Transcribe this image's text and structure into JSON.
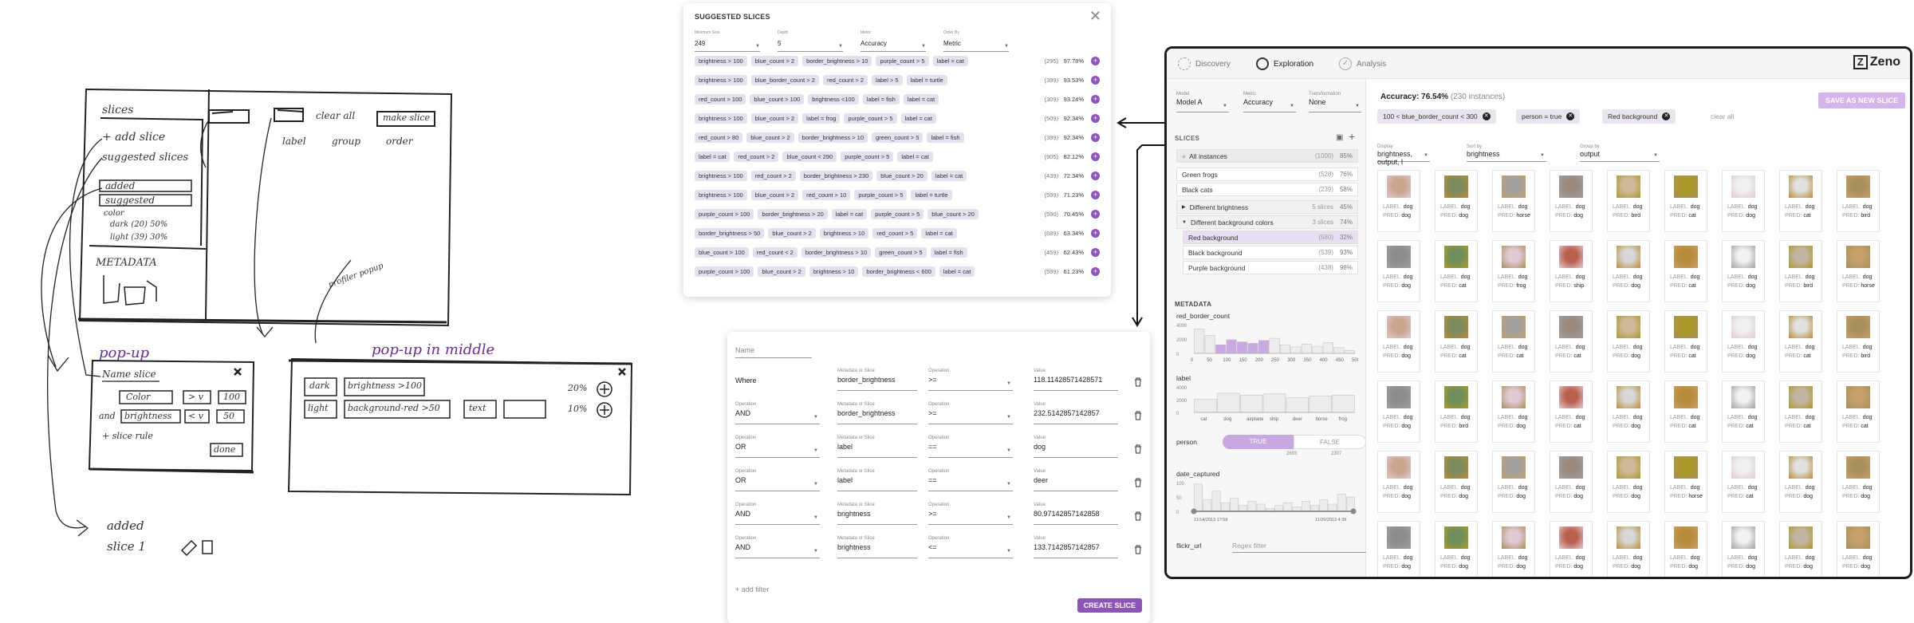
{
  "sketch": {
    "title": "slices",
    "add_slice": "+ add slice",
    "suggested_slices": "suggested slices",
    "added": "added",
    "suggested": "suggested",
    "color": "color",
    "dark": "dark (20) 50%",
    "light": "light (39) 30%",
    "metadata": "METADATA",
    "clear_all": "clear all",
    "make_slice": "make slice",
    "label": "label",
    "group": "group",
    "order": "order",
    "profiler_popup": "profiler popup",
    "popup_title": "pop-up",
    "popup_middle_title": "pop-up in middle",
    "name_slice": "Name slice",
    "color_field": "Color",
    "op_gt": "> v",
    "val_100": "100",
    "and": "and",
    "brightness_field": "brightness",
    "op_lt": "< v",
    "val_50": "50",
    "add_slice_rule": "+ slice rule",
    "done": "done",
    "mid_dark": "dark",
    "mid_bright": "brightness >100",
    "mid_20": "20%",
    "mid_light": "light",
    "mid_bg": "background-red >50",
    "mid_text": "text",
    "mid_10": "10%",
    "added_bottom": "added",
    "slice1": "slice 1"
  },
  "suggested": {
    "title": "SUGGESTED SLICES",
    "selects": [
      {
        "label": "Minimum Size",
        "value": "249"
      },
      {
        "label": "Depth",
        "value": "5"
      },
      {
        "label": "Metric",
        "value": "Accuracy"
      },
      {
        "label": "Order By",
        "value": "Metric"
      }
    ],
    "rows": [
      {
        "chips": [
          "brightness > 100",
          "blue_count > 2",
          "border_brightness > 10",
          "purple_count > 5",
          "label = cat"
        ],
        "count": "(295)",
        "pct": "97.78%"
      },
      {
        "chips": [
          "brightness > 100",
          "blue_border_count > 2",
          "red_count > 2",
          "label > 5",
          "label = turtle"
        ],
        "count": "(399)",
        "pct": "93.53%"
      },
      {
        "chips": [
          "red_count > 100",
          "blue_count > 100",
          "brightness <100",
          "label = fish",
          "label = cat"
        ],
        "count": "(309)",
        "pct": "93.24%"
      },
      {
        "chips": [
          "brightness > 100",
          "blue_count > 2",
          "label = frog",
          "purple_count > 5",
          "label = cat"
        ],
        "count": "(509)",
        "pct": "92.34%"
      },
      {
        "chips": [
          "red_count > 80",
          "blue_count > 2",
          "border_brightness > 10",
          "green_count > 5",
          "label = fish"
        ],
        "count": "(399)",
        "pct": "92.34%"
      },
      {
        "chips": [
          "label = cat",
          "red_count > 2",
          "blue_count < 290",
          "purple_count > 5",
          "label = cat"
        ],
        "count": "(905)",
        "pct": "82.12%"
      },
      {
        "chips": [
          "brightness > 100",
          "red_count > 2",
          "border_brightness > 230",
          "blue_count > 20",
          "label = cat"
        ],
        "count": "(439)",
        "pct": "72.34%"
      },
      {
        "chips": [
          "brightness > 100",
          "blue_count > 2",
          "red_count > 10",
          "purple_count > 5",
          "label = turtle"
        ],
        "count": "(599)",
        "pct": "71.23%"
      },
      {
        "chips": [
          "purple_count > 100",
          "border_brightness > 20",
          "label = cat",
          "purple_count > 5",
          "blue_count > 20"
        ],
        "count": "(590)",
        "pct": "70.45%"
      },
      {
        "chips": [
          "border_brightness > 50",
          "blue_count > 2",
          "brightness > 10",
          "red_count > 5",
          "label = cat"
        ],
        "count": "(689)",
        "pct": "63.34%"
      },
      {
        "chips": [
          "blue_count > 100",
          "red_count < 2",
          "border_brightness > 10",
          "green_count > 5",
          "label = fish"
        ],
        "count": "(459)",
        "pct": "62.43%"
      },
      {
        "chips": [
          "purple_count > 100",
          "blue_count > 2",
          "brightness > 10",
          "border_brightness < 600",
          "label = cat"
        ],
        "count": "(599)",
        "pct": "61.23%"
      }
    ]
  },
  "creator": {
    "name_placeholder": "Name",
    "where": "Where",
    "rows": [
      {
        "op_label": "",
        "op": "",
        "meta": "border_brightness",
        "oper": ">=",
        "value": "118.11428571428571"
      },
      {
        "op_label": "Operation",
        "op": "AND",
        "meta": "border_brightness",
        "oper": ">=",
        "value": "232.5142857142857"
      },
      {
        "op_label": "Operation",
        "op": "OR",
        "meta": "label",
        "oper": "==",
        "value": "dog"
      },
      {
        "op_label": "Operation",
        "op": "OR",
        "meta": "label",
        "oper": "==",
        "value": "deer"
      },
      {
        "op_label": "Operation",
        "op": "AND",
        "meta": "brightness",
        "oper": ">=",
        "value": "80.97142857142858"
      },
      {
        "op_label": "Operation",
        "op": "AND",
        "meta": "brightness",
        "oper": "<=",
        "value": "133.7142857142857"
      }
    ],
    "meta_label": "Metadata or Slice",
    "oper_label": "Operation",
    "value_label": "Value",
    "add_filter": "+ add filter",
    "create_button": "CREATE SLICE"
  },
  "zeno": {
    "tabs": {
      "discovery": "Discovery",
      "exploration": "Exploration",
      "analysis": "Analysis"
    },
    "logo": "Zeno",
    "model": {
      "label": "Model",
      "value": "Model A"
    },
    "metric": {
      "label": "Metric",
      "value": "Accuracy"
    },
    "transform": {
      "label": "Transformation",
      "value": "None"
    },
    "slices_header": "SLICES",
    "slices": [
      {
        "name": "All instances",
        "count": "(1000)",
        "pct": "85%"
      },
      {
        "name": "Green frogs",
        "count": "(528)",
        "pct": "76%"
      },
      {
        "name": "Black cats",
        "count": "(239)",
        "pct": "58%"
      },
      {
        "name": "Different brightness",
        "count": "5 slices",
        "pct": "45%"
      },
      {
        "name": "Different background colors",
        "count": "3 slices",
        "pct": "74%"
      },
      {
        "name": "Red background",
        "count": "(580)",
        "pct": "32%"
      },
      {
        "name": "Black background",
        "count": "(539)",
        "pct": "93%"
      },
      {
        "name": "Purple background",
        "count": "(438)",
        "pct": "98%"
      }
    ],
    "metadata_header": "METADATA",
    "red_border": {
      "title": "red_border_count",
      "yticks": [
        "4000",
        "2000",
        "0"
      ],
      "xticks": [
        "0",
        "50",
        "100",
        "150",
        "200",
        "250",
        "300",
        "350",
        "400",
        "450",
        "500"
      ],
      "values": [
        3400,
        2500,
        1200,
        1900,
        1600,
        1400,
        1800,
        2100,
        1200,
        900,
        1300,
        1000,
        1500,
        800,
        400
      ]
    },
    "label_hist": {
      "title": "label",
      "yticks": [
        "4000",
        "2000",
        "0"
      ],
      "categories": [
        "cat",
        "dog",
        "airplane",
        "ship",
        "deer",
        "horse",
        "frog"
      ],
      "values": [
        2100,
        3000,
        2700,
        2900,
        2300,
        2600,
        2700
      ]
    },
    "person": {
      "title": "person",
      "true_label": "TRUE",
      "false_label": "FALSE",
      "true_count": "2693",
      "false_count": "2307"
    },
    "date_captured": {
      "title": "date_captured",
      "yticks": [
        "100",
        "50",
        "0"
      ],
      "start": "11/14/2013 17:58",
      "end": "11/26/2013 4:39",
      "values": [
        95,
        40,
        70,
        30,
        45,
        20,
        35,
        25,
        10,
        20,
        30,
        15,
        35,
        20,
        40,
        25,
        60,
        50
      ]
    },
    "flickr": {
      "title": "flickr_url",
      "placeholder": "Regex filter"
    },
    "accuracy_label": "Accuracy: 76.54%",
    "instances_label": "(230 instances)",
    "filters": [
      "100 < blue_border_count < 300",
      "person = true",
      "Red background"
    ],
    "clear_all": "clear all",
    "save_button": "SAVE AS NEW SLICE",
    "display": {
      "label": "Display",
      "value": "brightness, output, l"
    },
    "sort": {
      "label": "Sort by",
      "value": "brightness"
    },
    "group": {
      "label": "Group by",
      "value": "output"
    },
    "label_prefix": "LABEL:",
    "pred_prefix": "PRED:",
    "cards": [
      [
        "dog",
        "dog"
      ],
      [
        "dog",
        "dog"
      ],
      [
        "dog",
        "horse"
      ],
      [
        "dog",
        "dog"
      ],
      [
        "dog",
        "bird"
      ],
      [
        "dog",
        "cat"
      ],
      [
        "dog",
        "dog"
      ],
      [
        "dog",
        "cat"
      ],
      [
        "dog",
        "bird"
      ],
      [
        "dog",
        "dog"
      ],
      [
        "dog",
        "cat"
      ],
      [
        "dog",
        "frog"
      ],
      [
        "dog",
        "ship"
      ],
      [
        "dog",
        "dog"
      ],
      [
        "dog",
        "cat"
      ],
      [
        "dog",
        "dog"
      ],
      [
        "dog",
        "bird"
      ],
      [
        "dog",
        "horse"
      ],
      [
        "dog",
        "dog"
      ],
      [
        "dog",
        "cat"
      ],
      [
        "dog",
        "cat"
      ],
      [
        "dog",
        "cat"
      ],
      [
        "dog",
        "dog"
      ],
      [
        "dog",
        "cat"
      ],
      [
        "dog",
        "dog"
      ],
      [
        "dog",
        "cat"
      ],
      [
        "dog",
        "bird"
      ],
      [
        "dog",
        "dog"
      ],
      [
        "dog",
        "bird"
      ],
      [
        "dog",
        "dog"
      ],
      [
        "dog",
        "cat"
      ],
      [
        "dog",
        "dog"
      ],
      [
        "dog",
        "cat"
      ],
      [
        "dog",
        "cat"
      ],
      [
        "dog",
        "cat"
      ],
      [
        "dog",
        "cat"
      ],
      [
        "dog",
        "dog"
      ],
      [
        "dog",
        "dog"
      ],
      [
        "dog",
        "dog"
      ],
      [
        "dog",
        "dog"
      ],
      [
        "dog",
        "dog"
      ],
      [
        "dog",
        "horse"
      ],
      [
        "dog",
        "cat"
      ],
      [
        "dog",
        "dog"
      ],
      [
        "dog",
        "dog"
      ],
      [
        "dog",
        "dog"
      ],
      [
        "dog",
        "dog"
      ],
      [
        "dog",
        "dog"
      ],
      [
        "dog",
        "dog"
      ],
      [
        "dog",
        "dog"
      ],
      [
        "dog",
        "dog"
      ],
      [
        "dog",
        "dog"
      ],
      [
        "dog",
        "dog"
      ],
      [
        "dog",
        "dog"
      ]
    ],
    "accent": "#8e55b8"
  }
}
